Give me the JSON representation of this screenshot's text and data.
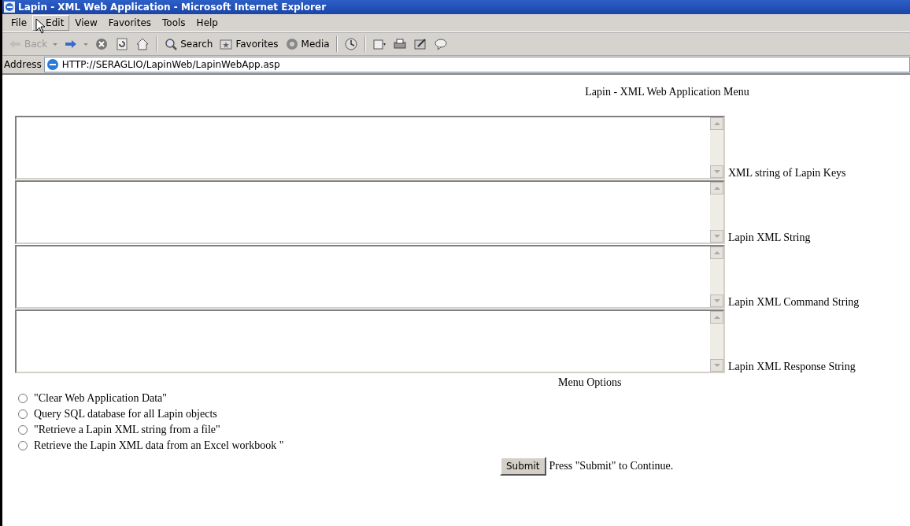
{
  "window": {
    "title": "Lapin - XML Web Application - Microsoft Internet Explorer"
  },
  "menu": [
    {
      "label": "File",
      "highlighted": false
    },
    {
      "label": "Edit",
      "highlighted": true
    },
    {
      "label": "View",
      "highlighted": false
    },
    {
      "label": "Favorites",
      "highlighted": false
    },
    {
      "label": "Tools",
      "highlighted": false
    },
    {
      "label": "Help",
      "highlighted": false
    }
  ],
  "toolbar": [
    {
      "kind": "back",
      "label": "Back",
      "disabled": true
    },
    {
      "kind": "forward",
      "disabled": false
    },
    {
      "kind": "stop",
      "disabled": false
    },
    {
      "kind": "refresh",
      "disabled": false
    },
    {
      "kind": "home",
      "disabled": false
    },
    {
      "kind": "search",
      "label": "Search",
      "disabled": false
    },
    {
      "kind": "favorites",
      "label": "Favorites",
      "disabled": false
    },
    {
      "kind": "media",
      "label": "Media",
      "disabled": false
    },
    {
      "kind": "history",
      "disabled": false
    },
    {
      "kind": "mail",
      "disabled": false
    },
    {
      "kind": "print",
      "disabled": false
    },
    {
      "kind": "edit",
      "disabled": false
    },
    {
      "kind": "discuss",
      "disabled": false
    }
  ],
  "address": {
    "label": "Address",
    "value": "HTTP://SERAGLIO/LapinWeb/LapinWebApp.asp"
  },
  "page": {
    "heading": "Lapin - XML Web Application Menu",
    "fields": [
      {
        "label": "XML string of Lapin Keys"
      },
      {
        "label": "Lapin XML String"
      },
      {
        "label": "Lapin XML Command String"
      },
      {
        "label": "Lapin XML Response String"
      }
    ],
    "options_heading": "Menu Options",
    "options": [
      {
        "label": "\"Clear Web Application Data\"",
        "selected": false
      },
      {
        "label": "Query SQL database for all Lapin objects",
        "selected": false
      },
      {
        "label": "\"Retrieve a Lapin XML string from a file\"",
        "selected": false
      },
      {
        "label": "Retrieve the Lapin XML data from an Excel workbook \"",
        "selected": false
      }
    ],
    "submit": {
      "label": "Submit",
      "hint": "Press \"Submit\" to Continue."
    }
  }
}
